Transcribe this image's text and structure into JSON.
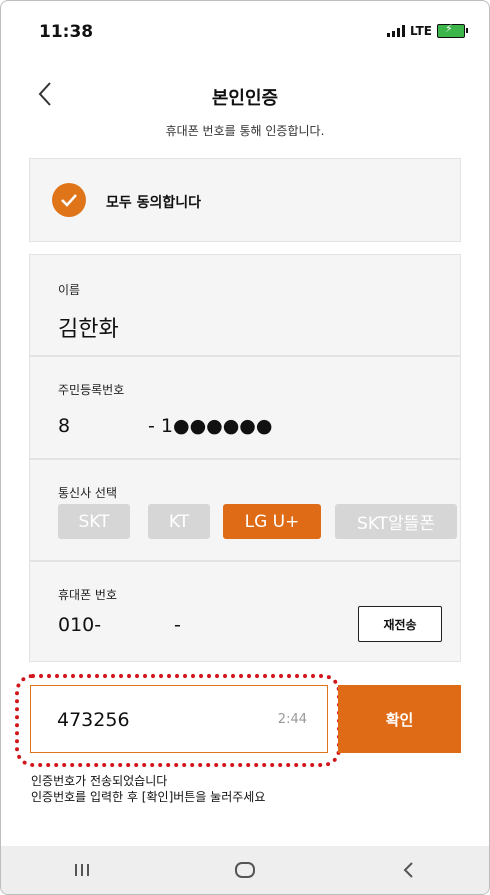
{
  "status_bar": {
    "time": "11:38",
    "network": "LTE",
    "icons": [
      "signal-icon",
      "battery-charging-icon"
    ]
  },
  "header": {
    "title": "본인인증",
    "subtitle": "휴대폰 번호를 통해 인증합니다."
  },
  "agree": {
    "label": "모두 동의합니다",
    "checked": true
  },
  "name_field": {
    "label": "이름",
    "value": "김한화"
  },
  "rrn_field": {
    "label": "주민등록번호",
    "front": "8",
    "back": "- 1●●●●●●"
  },
  "carrier": {
    "label": "통신사 선택",
    "options": [
      "SKT",
      "KT",
      "LG U+",
      "SKT알뜰폰"
    ],
    "selected": "LG U+"
  },
  "phone_field": {
    "label": "휴대폰 번호",
    "prefix": "010-",
    "separator": "-",
    "resend_label": "재전송"
  },
  "verification": {
    "code": "473256",
    "timer": "2:44",
    "confirm_label": "확인"
  },
  "notes": [
    "인증번호가 전송되었습니다",
    "인증번호를 입력한 후 [확인]버튼을 눌러주세요"
  ],
  "colors": {
    "accent": "#e06b16",
    "highlight": "#d0151b",
    "inactive_pill": "#d6d6d6"
  },
  "nav": [
    "recents-icon",
    "home-icon",
    "back-icon"
  ]
}
